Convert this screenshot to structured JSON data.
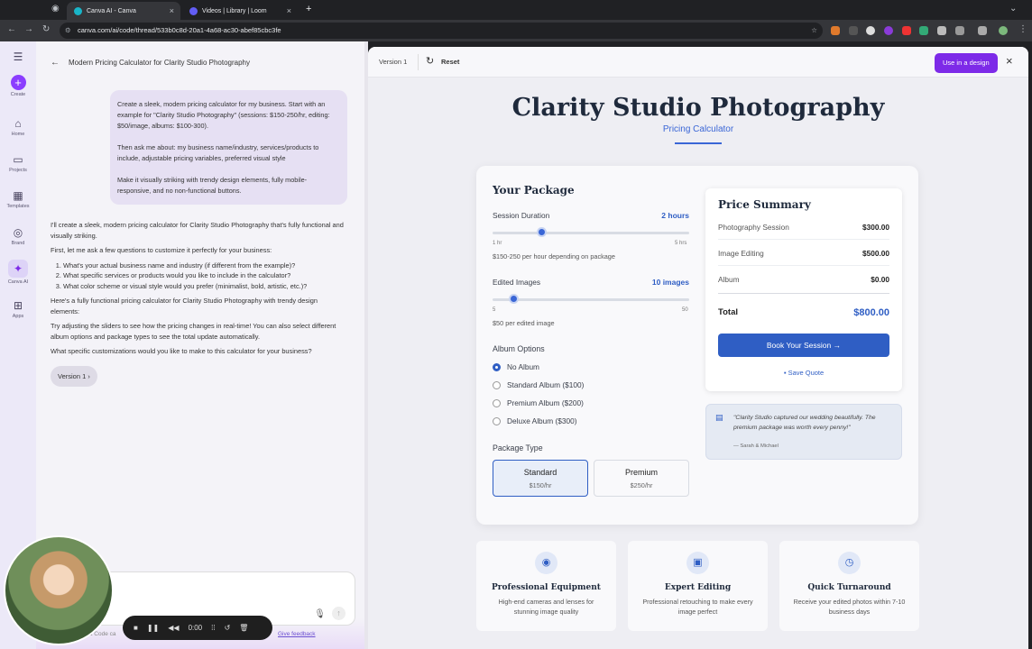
{
  "browser": {
    "tabs": [
      {
        "title": "Canva AI - Canva",
        "active": true
      },
      {
        "title": "Videos | Library | Loom",
        "active": false
      }
    ],
    "new_tab": "+",
    "url": "canva.com/ai/code/thread/533b0c8d-20a1-4a68-ac30-abef85cbc3fe"
  },
  "rail": {
    "items": [
      {
        "label": "Create",
        "icon": "plus-icon"
      },
      {
        "label": "Home",
        "icon": "home-icon"
      },
      {
        "label": "Projects",
        "icon": "folder-icon"
      },
      {
        "label": "Templates",
        "icon": "templates-icon"
      },
      {
        "label": "Brand",
        "icon": "brand-icon"
      },
      {
        "label": "Canva AI",
        "icon": "sparkle-icon"
      },
      {
        "label": "Apps",
        "icon": "apps-icon"
      }
    ]
  },
  "chat": {
    "title": "Modern Pricing Calculator for Clarity Studio Photography",
    "user_message": [
      "Create a sleek, modern pricing calculator for my business. Start with an example for \"Clarity Studio Photography\" (sessions: $150-250/hr, editing: $50/image, albums: $100-300).",
      "Then ask me about: my business name/industry, services/products to include, adjustable pricing variables, preferred visual style",
      "Make it visually striking with trendy design elements, fully mobile-responsive, and no non-functional buttons."
    ],
    "response_intro": "I'll create a sleek, modern pricing calculator for Clarity Studio Photography that's fully functional and visually striking.",
    "response_ask": "First, let me ask a few questions to customize it perfectly for your business:",
    "questions": [
      "What's your actual business name and industry (if different from the example)?",
      "What specific services or products would you like to include in the calculator?",
      "What color scheme or visual style would you prefer (minimalist, bold, artistic, etc.)?"
    ],
    "response_here": "Here's a fully functional pricing calculator for Clarity Studio Photography with trendy design elements:",
    "response_try": "Try adjusting the sliders to see how the pricing changes in real-time! You can also select different album options and package types to see the total update automatically.",
    "response_final": "What specific customizations would you like to make to this calculator for your business?",
    "version_button": "Version 1",
    "footer_partial": "nva Code ca",
    "feedback": "Give feedback"
  },
  "preview_bar": {
    "version": "Version 1",
    "reset": "Reset",
    "use_in_design": "Use in a design"
  },
  "calculator": {
    "title": "Clarity Studio Photography",
    "subtitle": "Pricing Calculator",
    "package_heading": "Your Package",
    "session": {
      "label": "Session Duration",
      "value": "2 hours",
      "min": "1 hr",
      "max": "5 hrs",
      "note": "$150-250 per hour depending on package",
      "level": 0.25
    },
    "images": {
      "label": "Edited Images",
      "value": "10 images",
      "min": "5",
      "max": "50",
      "note": "$50 per edited image",
      "level": 0.11
    },
    "album_heading": "Album Options",
    "albums": [
      {
        "label": "No Album",
        "selected": true
      },
      {
        "label": "Standard Album ($100)",
        "selected": false
      },
      {
        "label": "Premium Album ($200)",
        "selected": false
      },
      {
        "label": "Deluxe Album ($300)",
        "selected": false
      }
    ],
    "package_type_heading": "Package Type",
    "packages": [
      {
        "name": "Standard",
        "price": "$150/hr",
        "selected": true
      },
      {
        "name": "Premium",
        "price": "$250/hr",
        "selected": false
      }
    ],
    "summary": {
      "heading": "Price Summary",
      "rows": [
        {
          "label": "Photography Session",
          "value": "$300.00"
        },
        {
          "label": "Image Editing",
          "value": "$500.00"
        },
        {
          "label": "Album",
          "value": "$0.00"
        }
      ],
      "total_label": "Total",
      "total_value": "$800.00",
      "book": "Book Your Session →",
      "save": "Save Quote"
    },
    "testimonial": {
      "quote": "\"Clarity Studio captured our wedding beautifully. The premium package was worth every penny!\"",
      "author": "— Sarah & Michael"
    },
    "features": [
      {
        "title": "Professional Equipment",
        "text": "High-end cameras and lenses for stunning image quality",
        "icon": "camera-icon"
      },
      {
        "title": "Expert Editing",
        "text": "Professional retouching to make every image perfect",
        "icon": "editing-icon"
      },
      {
        "title": "Quick Turnaround",
        "text": "Receive your edited photos within 7-10 business days",
        "icon": "clock-icon"
      }
    ]
  },
  "loom": {
    "time": "0:00"
  },
  "colors": {
    "accent": "#2f5ec4",
    "canva_purple": "#7d2ae8"
  }
}
